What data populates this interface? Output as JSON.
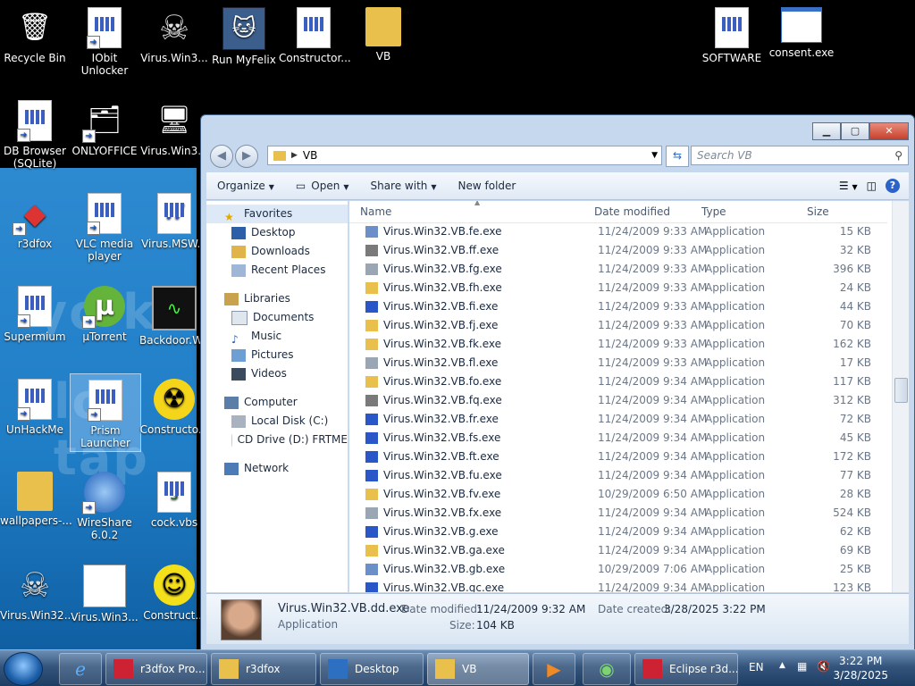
{
  "desktop": {
    "icons": [
      {
        "label": "Recycle Bin"
      },
      {
        "label": "IObit Unlocker"
      },
      {
        "label": "Virus.Win3..."
      },
      {
        "label": "Run MyFelix"
      },
      {
        "label": "Constructor..."
      },
      {
        "label": "VB"
      },
      {
        "label": "SOFTWARE"
      },
      {
        "label": "consent.exe"
      },
      {
        "label": "DB Browser (SQLite)"
      },
      {
        "label": "ONLYOFFICE"
      },
      {
        "label": "Virus.Win3..."
      },
      {
        "label": "r3dfox"
      },
      {
        "label": "VLC media player"
      },
      {
        "label": "Virus.MSW..."
      },
      {
        "label": "Supermium"
      },
      {
        "label": "µTorrent"
      },
      {
        "label": "Backdoor.W..."
      },
      {
        "label": "UnHackMe"
      },
      {
        "label": "Prism Launcher"
      },
      {
        "label": "Constructo..."
      },
      {
        "label": "wallpapers-..."
      },
      {
        "label": "WireShare 6.0.2"
      },
      {
        "label": "cock.vbs"
      },
      {
        "label": "Virus.Win32..."
      },
      {
        "label": "Virus.Win3..."
      },
      {
        "label": "Construct..."
      }
    ]
  },
  "explorer": {
    "breadcrumb": "VB",
    "search_placeholder": "Search VB",
    "toolbar": {
      "organize": "Organize",
      "open": "Open",
      "share_with": "Share with",
      "new_folder": "New folder"
    },
    "nav": [
      {
        "label": "Favorites",
        "level": 0
      },
      {
        "label": "Desktop",
        "level": 1
      },
      {
        "label": "Downloads",
        "level": 1
      },
      {
        "label": "Recent Places",
        "level": 1
      },
      {
        "label": "Libraries",
        "level": 0
      },
      {
        "label": "Documents",
        "level": 1
      },
      {
        "label": "Music",
        "level": 1
      },
      {
        "label": "Pictures",
        "level": 1
      },
      {
        "label": "Videos",
        "level": 1
      },
      {
        "label": "Computer",
        "level": 0
      },
      {
        "label": "Local Disk (C:)",
        "level": 1
      },
      {
        "label": "CD Drive (D:) FRTME",
        "level": 1
      },
      {
        "label": "Network",
        "level": 0
      }
    ],
    "columns": {
      "name": "Name",
      "date": "Date modified",
      "type": "Type",
      "size": "Size"
    },
    "files": [
      {
        "name": "Virus.Win32.VB.fe.exe",
        "date": "11/24/2009 9:33 AM",
        "type": "Application",
        "size": "15 KB"
      },
      {
        "name": "Virus.Win32.VB.ff.exe",
        "date": "11/24/2009 9:33 AM",
        "type": "Application",
        "size": "32 KB"
      },
      {
        "name": "Virus.Win32.VB.fg.exe",
        "date": "11/24/2009 9:33 AM",
        "type": "Application",
        "size": "396 KB"
      },
      {
        "name": "Virus.Win32.VB.fh.exe",
        "date": "11/24/2009 9:33 AM",
        "type": "Application",
        "size": "24 KB"
      },
      {
        "name": "Virus.Win32.VB.fi.exe",
        "date": "11/24/2009 9:33 AM",
        "type": "Application",
        "size": "44 KB"
      },
      {
        "name": "Virus.Win32.VB.fj.exe",
        "date": "11/24/2009 9:33 AM",
        "type": "Application",
        "size": "70 KB"
      },
      {
        "name": "Virus.Win32.VB.fk.exe",
        "date": "11/24/2009 9:33 AM",
        "type": "Application",
        "size": "162 KB"
      },
      {
        "name": "Virus.Win32.VB.fl.exe",
        "date": "11/24/2009 9:33 AM",
        "type": "Application",
        "size": "17 KB"
      },
      {
        "name": "Virus.Win32.VB.fo.exe",
        "date": "11/24/2009 9:34 AM",
        "type": "Application",
        "size": "117 KB"
      },
      {
        "name": "Virus.Win32.VB.fq.exe",
        "date": "11/24/2009 9:34 AM",
        "type": "Application",
        "size": "312 KB"
      },
      {
        "name": "Virus.Win32.VB.fr.exe",
        "date": "11/24/2009 9:34 AM",
        "type": "Application",
        "size": "72 KB"
      },
      {
        "name": "Virus.Win32.VB.fs.exe",
        "date": "11/24/2009 9:34 AM",
        "type": "Application",
        "size": "45 KB"
      },
      {
        "name": "Virus.Win32.VB.ft.exe",
        "date": "11/24/2009 9:34 AM",
        "type": "Application",
        "size": "172 KB"
      },
      {
        "name": "Virus.Win32.VB.fu.exe",
        "date": "11/24/2009 9:34 AM",
        "type": "Application",
        "size": "77 KB"
      },
      {
        "name": "Virus.Win32.VB.fv.exe",
        "date": "10/29/2009 6:50 AM",
        "type": "Application",
        "size": "28 KB"
      },
      {
        "name": "Virus.Win32.VB.fx.exe",
        "date": "11/24/2009 9:34 AM",
        "type": "Application",
        "size": "524 KB"
      },
      {
        "name": "Virus.Win32.VB.g.exe",
        "date": "11/24/2009 9:34 AM",
        "type": "Application",
        "size": "62 KB"
      },
      {
        "name": "Virus.Win32.VB.ga.exe",
        "date": "11/24/2009 9:34 AM",
        "type": "Application",
        "size": "69 KB"
      },
      {
        "name": "Virus.Win32.VB.gb.exe",
        "date": "10/29/2009 7:06 AM",
        "type": "Application",
        "size": "25 KB"
      },
      {
        "name": "Virus.Win32.VB.gc.exe",
        "date": "11/24/2009 9:34 AM",
        "type": "Application",
        "size": "123 KB"
      }
    ],
    "details": {
      "name": "Virus.Win32.VB.dd.exe",
      "type": "Application",
      "date_modified_label": "Date modified:",
      "date_modified": "11/24/2009 9:32 AM",
      "date_created_label": "Date created:",
      "date_created": "3/28/2025 3:22 PM",
      "size_label": "Size:",
      "size": "104 KB"
    }
  },
  "taskbar": {
    "items": [
      {
        "label": "r3dfox Pro..."
      },
      {
        "label": "r3dfox"
      },
      {
        "label": "Desktop"
      },
      {
        "label": "VB"
      },
      {
        "label": "Eclipse r3d..."
      }
    ],
    "lang": "EN",
    "time": "3:22 PM",
    "date": "3/28/2025"
  }
}
